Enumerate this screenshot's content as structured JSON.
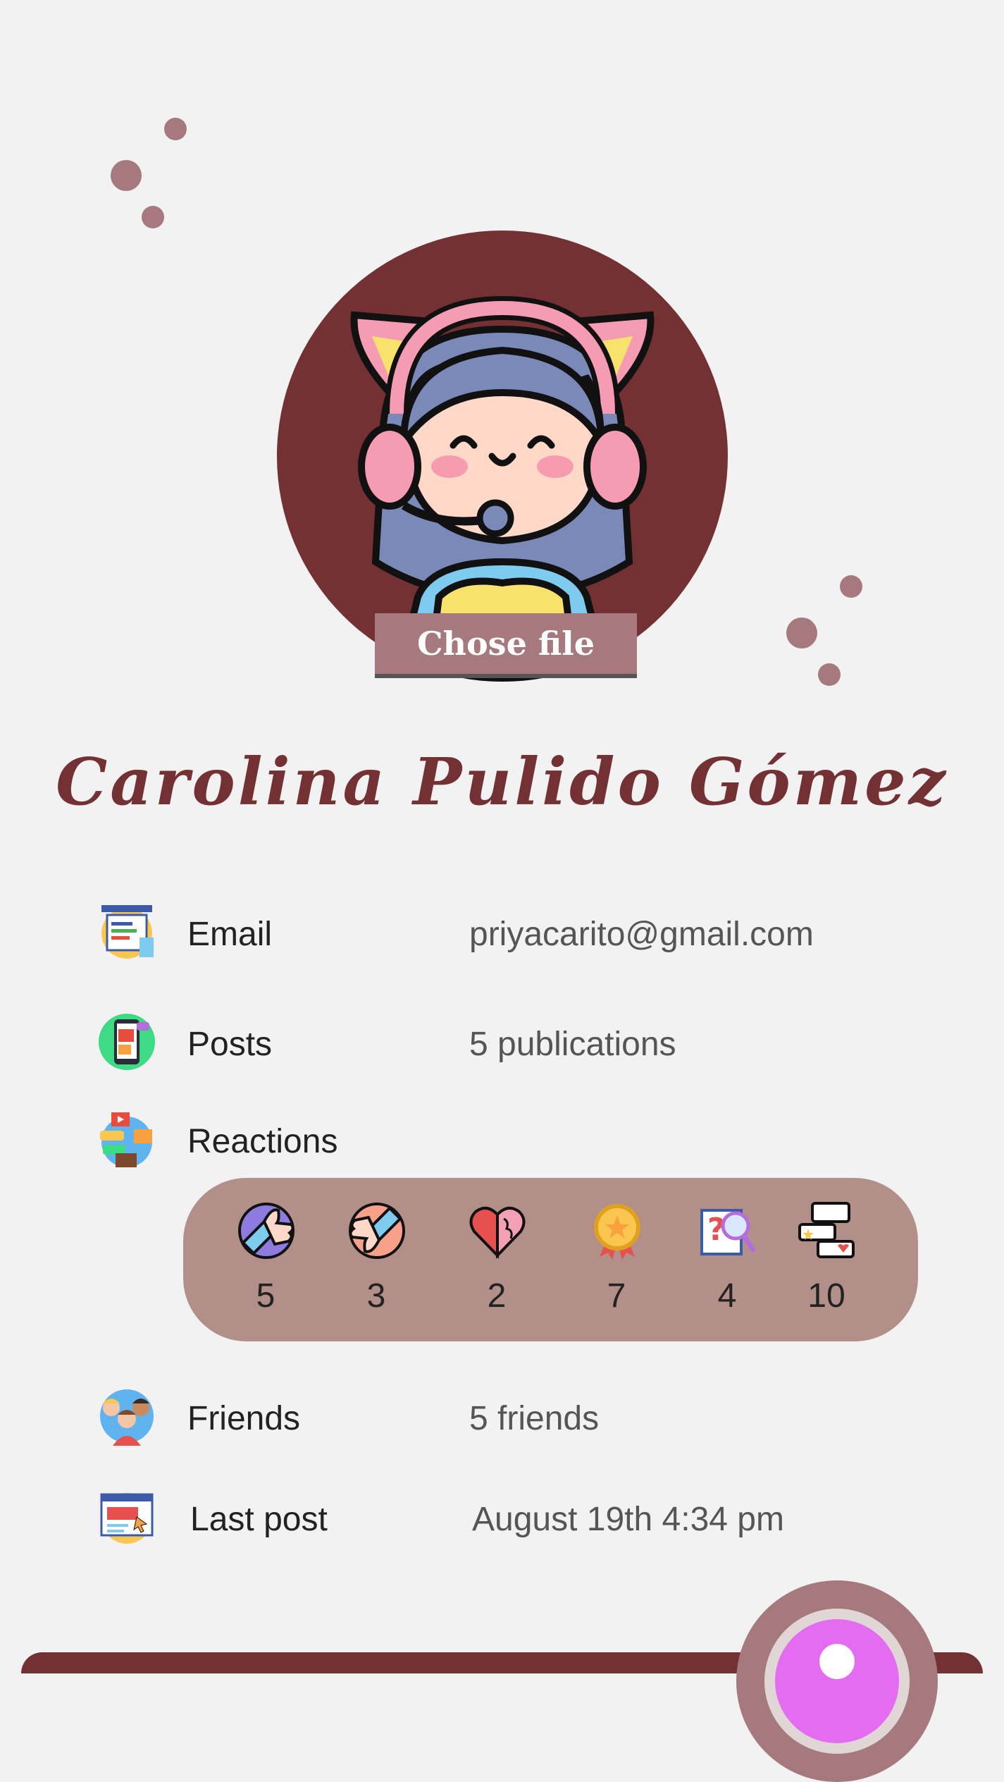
{
  "profile": {
    "choose_file_label": "Chose file",
    "name": "Carolina Pulido Gómez"
  },
  "fields": {
    "email": {
      "label": "Email",
      "value": "priyacarito@gmail.com",
      "icon": "email-list-icon"
    },
    "posts": {
      "label": "Posts",
      "value": "5 publications",
      "icon": "phone-post-icon"
    },
    "reactions": {
      "label": "Reactions",
      "icon": "media-reactions-icon"
    },
    "friends": {
      "label": "Friends",
      "value": "5 friends",
      "icon": "friends-group-icon"
    },
    "last_post": {
      "label": "Last post",
      "value": "August 19th 4:34 pm",
      "icon": "browser-post-icon"
    }
  },
  "reactions": [
    {
      "icon": "thumbs-up-icon",
      "count": "5"
    },
    {
      "icon": "thumbs-down-icon",
      "count": "3"
    },
    {
      "icon": "heart-brain-icon",
      "count": "2"
    },
    {
      "icon": "medal-icon",
      "count": "7"
    },
    {
      "icon": "question-search-icon",
      "count": "4"
    },
    {
      "icon": "chat-bubbles-icon",
      "count": "10"
    }
  ],
  "colors": {
    "background": "#f2f2f2",
    "accent": "#733134",
    "muted": "#a6797e",
    "reactions_bg": "#b29089",
    "fab": "#e36cf0"
  }
}
